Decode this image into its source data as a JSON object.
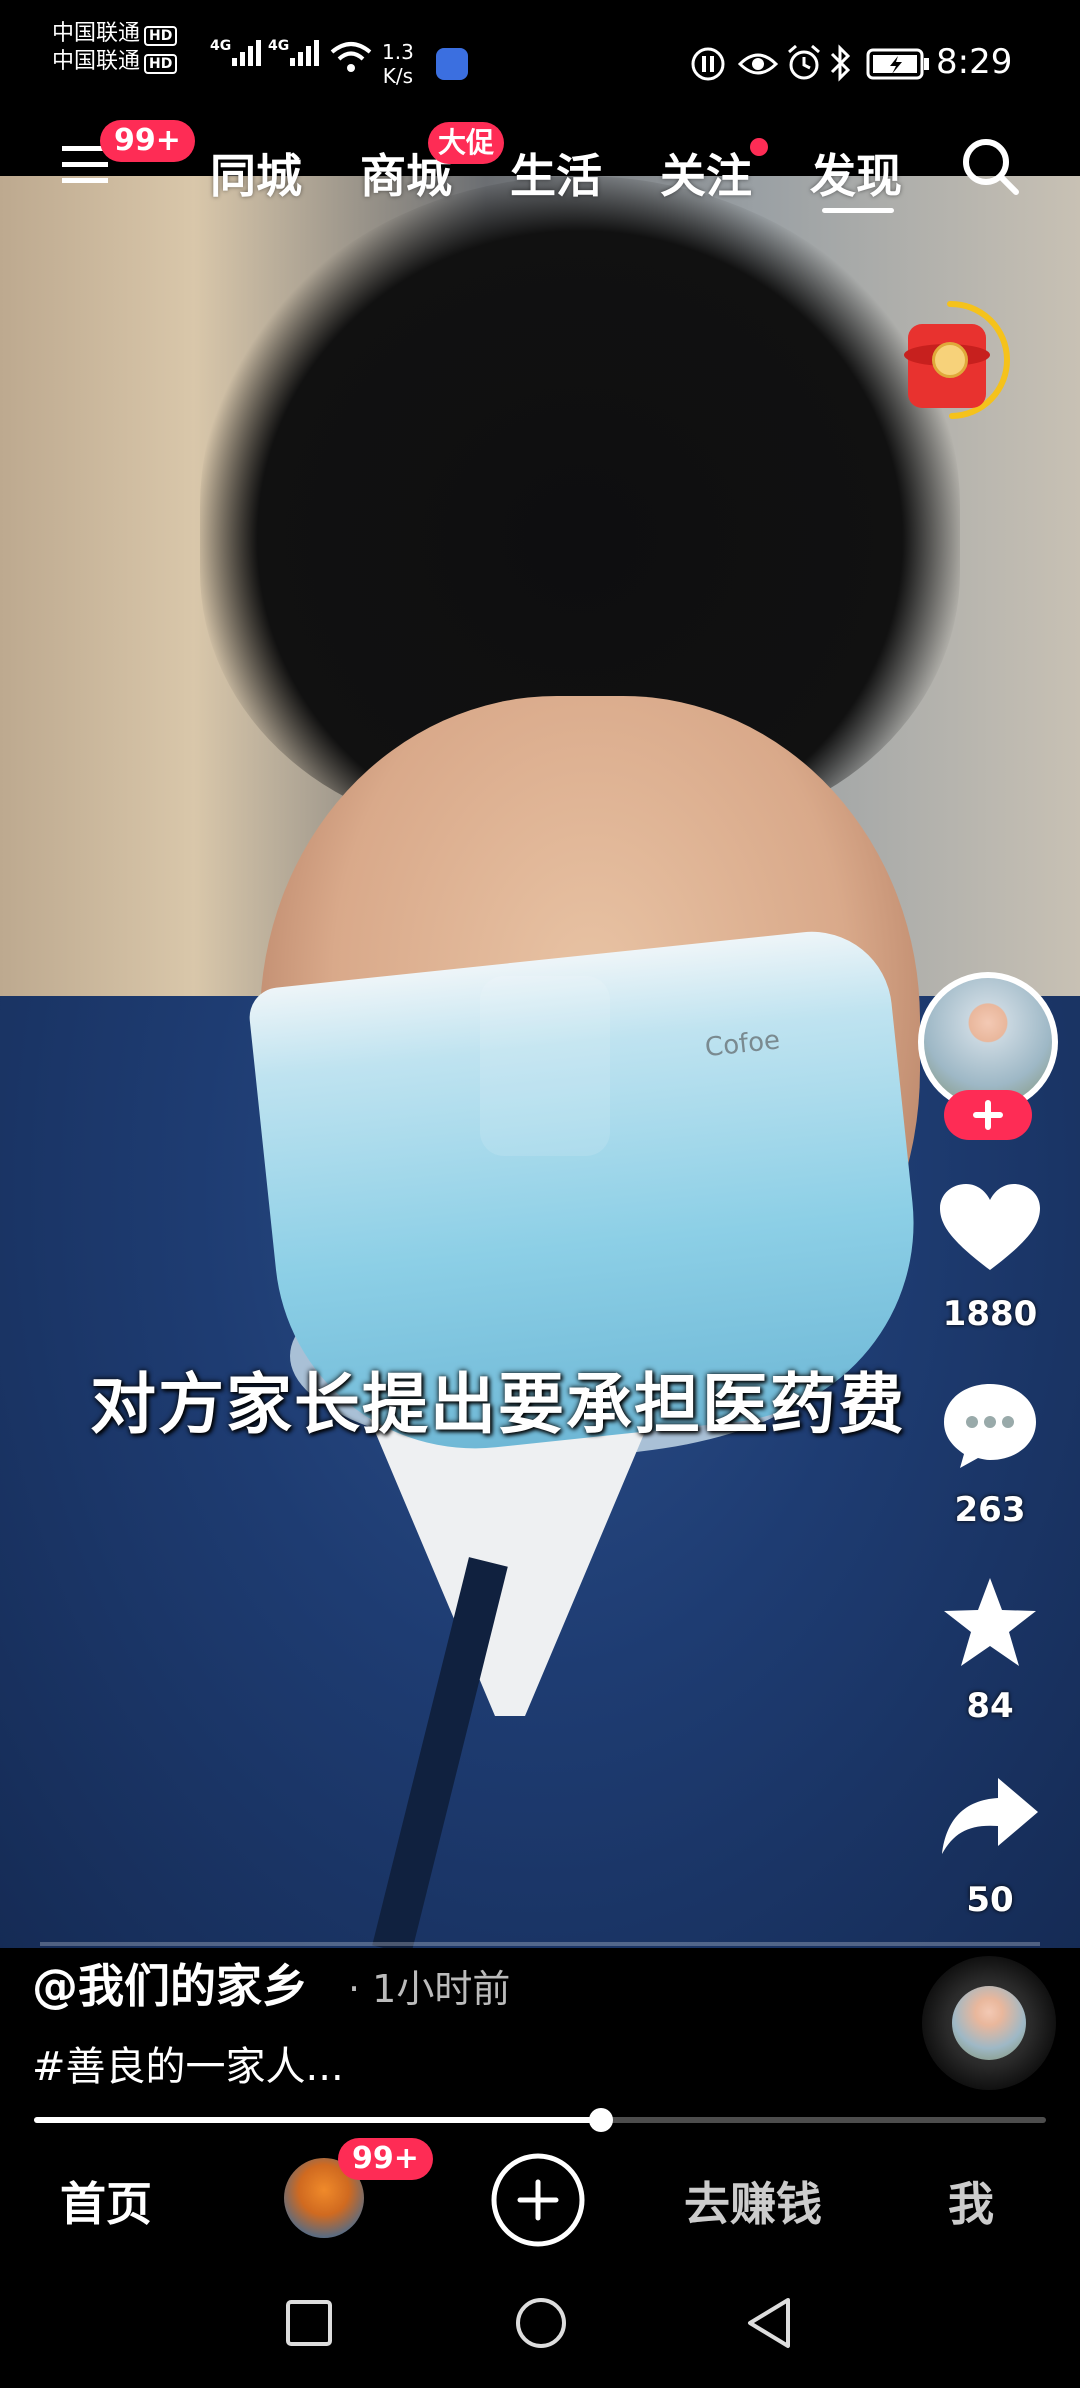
{
  "status_bar": {
    "carrier1": "中国联通",
    "carrier2": "中国联通",
    "hd": "HD",
    "net1": "4G",
    "net2": "4G",
    "speed_value": "1.3",
    "speed_unit": "K/s",
    "time": "8:29"
  },
  "top_nav": {
    "menu_badge": "99+",
    "tabs": [
      {
        "label": "同城"
      },
      {
        "label": "商城",
        "badge": "大促"
      },
      {
        "label": "生活"
      },
      {
        "label": "关注"
      },
      {
        "label": "发现",
        "active": true
      }
    ]
  },
  "video": {
    "subtitle": "对方家长提出要承担医药费",
    "mask_print": "Cofoe"
  },
  "right_rail": {
    "like_count": "1880",
    "comment_count": "263",
    "favorite_count": "84",
    "share_count": "50"
  },
  "post": {
    "author": "@我们的家乡",
    "time_ago": "· 1小时前",
    "caption": "#善良的一家人...",
    "progress": 0.56
  },
  "bottom_tabs": {
    "home": "首页",
    "friends_badge": "99+",
    "earn": "去赚钱",
    "me": "我"
  },
  "colors": {
    "accent": "#fe2c55",
    "timer_ring": "#f5c21b",
    "background": "#000000"
  }
}
